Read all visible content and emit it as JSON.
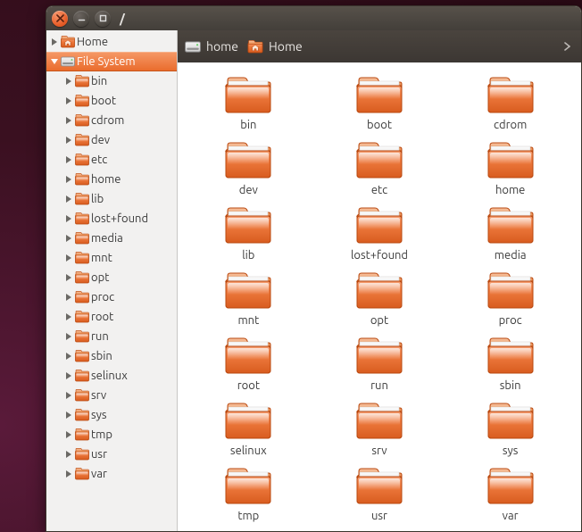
{
  "window": {
    "title": "/"
  },
  "sidebar": {
    "places": [
      {
        "label": "Home",
        "icon": "home",
        "expanded": false,
        "selected": false,
        "depth": 0
      },
      {
        "label": "File System",
        "icon": "drive",
        "expanded": true,
        "selected": true,
        "depth": 0
      }
    ],
    "fs_children": [
      {
        "label": "bin"
      },
      {
        "label": "boot"
      },
      {
        "label": "cdrom"
      },
      {
        "label": "dev"
      },
      {
        "label": "etc"
      },
      {
        "label": "home"
      },
      {
        "label": "lib"
      },
      {
        "label": "lost+found"
      },
      {
        "label": "media"
      },
      {
        "label": "mnt"
      },
      {
        "label": "opt"
      },
      {
        "label": "proc"
      },
      {
        "label": "root"
      },
      {
        "label": "run"
      },
      {
        "label": "sbin"
      },
      {
        "label": "selinux"
      },
      {
        "label": "srv"
      },
      {
        "label": "sys"
      },
      {
        "label": "tmp"
      },
      {
        "label": "usr"
      },
      {
        "label": "var"
      }
    ]
  },
  "breadcrumb": [
    {
      "label": "home",
      "icon": "drive"
    },
    {
      "label": "Home",
      "icon": "home-orange"
    }
  ],
  "grid_items": [
    {
      "label": "bin"
    },
    {
      "label": "boot"
    },
    {
      "label": "cdrom"
    },
    {
      "label": "dev"
    },
    {
      "label": "etc"
    },
    {
      "label": "home"
    },
    {
      "label": "lib"
    },
    {
      "label": "lost+found"
    },
    {
      "label": "media"
    },
    {
      "label": "mnt"
    },
    {
      "label": "opt"
    },
    {
      "label": "proc"
    },
    {
      "label": "root"
    },
    {
      "label": "run"
    },
    {
      "label": "sbin"
    },
    {
      "label": "selinux"
    },
    {
      "label": "srv"
    },
    {
      "label": "sys"
    },
    {
      "label": "tmp"
    },
    {
      "label": "usr"
    },
    {
      "label": "var"
    }
  ],
  "colors": {
    "accent": "#ea6c2d"
  }
}
